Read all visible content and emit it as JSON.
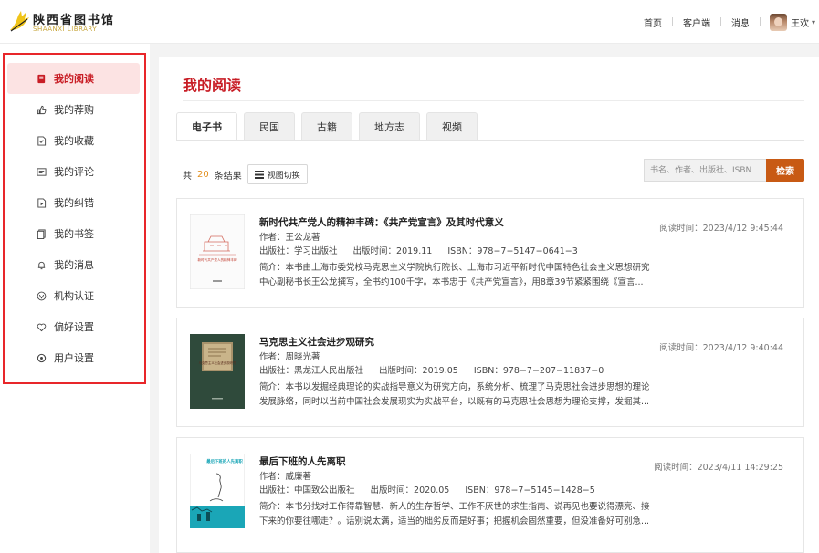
{
  "logo": {
    "cn": "陕西省图书馆",
    "en": "SHAANXI LIBRARY"
  },
  "topnav": {
    "home": "首页",
    "client": "客户端",
    "messages": "消息",
    "user_name": "王欢"
  },
  "sidebar": {
    "items": [
      {
        "label": "我的阅读",
        "icon": "book-icon",
        "active": true
      },
      {
        "label": "我的荐购",
        "icon": "thumb-up-icon",
        "active": false
      },
      {
        "label": "我的收藏",
        "icon": "favorite-icon",
        "active": false
      },
      {
        "label": "我的评论",
        "icon": "comment-icon",
        "active": false
      },
      {
        "label": "我的纠错",
        "icon": "correction-icon",
        "active": false
      },
      {
        "label": "我的书签",
        "icon": "bookmark-icon",
        "active": false
      },
      {
        "label": "我的消息",
        "icon": "bell-icon",
        "active": false
      },
      {
        "label": "机构认证",
        "icon": "certification-icon",
        "active": false
      },
      {
        "label": "偏好设置",
        "icon": "heart-icon",
        "active": false
      },
      {
        "label": "用户设置",
        "icon": "settings-icon",
        "active": false
      }
    ]
  },
  "main": {
    "title": "我的阅读",
    "tabs": [
      "电子书",
      "民国",
      "古籍",
      "地方志",
      "视频"
    ],
    "active_tab": "电子书",
    "result": {
      "prefix": "共",
      "count": "20",
      "suffix": "条结果"
    },
    "view_toggle": "视图切换",
    "search": {
      "placeholder": "书名、作者、出版社、ISBN",
      "button": "检索"
    }
  },
  "books": [
    {
      "title": "新时代共产党人的精神丰碑：《共产党宣言》及其时代意义",
      "author": "作者：王公龙著",
      "publisher": "出版社：学习出版社",
      "pubdate": "出版时间：2019.11",
      "isbn": "ISBN：978−7−5147−0641−3",
      "desc1": "简介：本书由上海市委党校马克思主义学院执行院长、上海市习近平新时代中国特色社会主义思想研究",
      "desc2": "中心副秘书长王公龙撰写，全书约100千字。本书忠于《共产党宣言》，用8章39节紧紧围绕《宣言...",
      "read_time": "阅读时间：2023/4/12 9:45:44",
      "cover_title": "新时代共产党人的精神丰碑"
    },
    {
      "title": "马克思主义社会进步观研究",
      "author": "作者：周晓光著",
      "publisher": "出版社：黑龙江人民出版社",
      "pubdate": "出版时间：2019.05",
      "isbn": "ISBN：978−7−207−11837−0",
      "desc1": "简介：本书以发掘经典理论的实战指导意义为研究方向，系统分析、梳理了马克思社会进步思想的理论",
      "desc2": "发展脉络，同时以当前中国社会发展现实为实战平台，以既有的马克思社会思想为理论支撑，发掘其...",
      "read_time": "阅读时间：2023/4/12 9:40:44",
      "cover_title": "马克思主义社会进步观研究"
    },
    {
      "title": "最后下班的人先离职",
      "author": "作者：威廉著",
      "publisher": "出版社：中国致公出版社",
      "pubdate": "出版时间：2020.05",
      "isbn": "ISBN：978−7−5145−1428−5",
      "desc1": "简介：本书分找对工作得靠智慧、新人的生存哲学、工作不厌世的求生指南、说再见也要说得漂亮、接",
      "desc2": "下来的你要往哪走？。话别说太满，适当的拙劣反而是好事；把握机会固然重要，但没准备好可别急...",
      "read_time": "阅读时间：2023/4/11 14:29:25",
      "cover_title": "最后下班的人先离职"
    }
  ],
  "colors": {
    "accent": "#c81d25",
    "count": "#e39121",
    "search_button": "#c85a14",
    "highlight_box": "#e8262a"
  }
}
